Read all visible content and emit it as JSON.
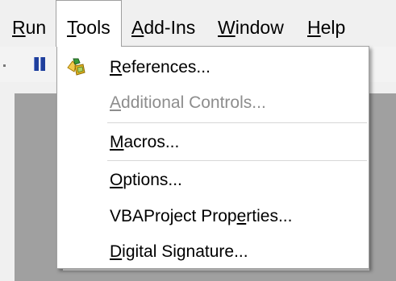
{
  "menubar": {
    "items": [
      {
        "mnemonic": "R",
        "rest": "un"
      },
      {
        "mnemonic": "T",
        "rest": "ools"
      },
      {
        "mnemonic": "A",
        "rest": "dd-Ins"
      },
      {
        "mnemonic": "W",
        "rest": "indow"
      },
      {
        "mnemonic": "H",
        "rest": "elp"
      }
    ]
  },
  "tools_menu": {
    "items": [
      {
        "pre": "",
        "mnemonic": "R",
        "post": "eferences...",
        "icon": "references-icon",
        "disabled": false
      },
      {
        "pre": "",
        "mnemonic": "A",
        "post": "dditional Controls...",
        "disabled": true
      },
      {
        "pre": "",
        "mnemonic": "M",
        "post": "acros...",
        "disabled": false
      },
      {
        "pre": "",
        "mnemonic": "O",
        "post": "ptions...",
        "disabled": false
      },
      {
        "pre": "VBAProject Prop",
        "mnemonic": "e",
        "post": "rties...",
        "disabled": false
      },
      {
        "pre": "",
        "mnemonic": "D",
        "post": "igital Signature...",
        "disabled": false
      }
    ]
  },
  "colors": {
    "menu_background": "#ffffff",
    "disabled_text": "#8d8d8d",
    "workarea": "#a0a0a0",
    "pause_icon": "#1f3f9c"
  },
  "icons": [
    "pause-icon",
    "references-icon"
  ]
}
